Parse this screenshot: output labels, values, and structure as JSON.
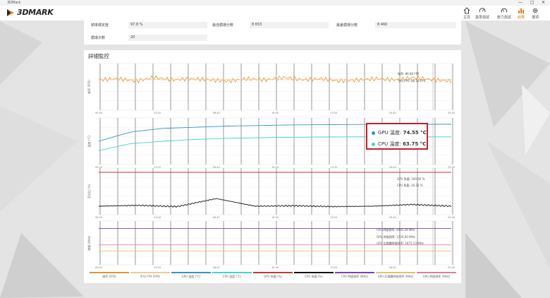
{
  "window": {
    "title": "3DMark",
    "controls": [
      "—",
      "□",
      "✕"
    ]
  },
  "app": {
    "logo_text": "3DMARK",
    "accent": "#d97a1c"
  },
  "nav": [
    {
      "label": "主頁",
      "icon": "home-icon"
    },
    {
      "label": "基準測試",
      "icon": "speedometer-icon"
    },
    {
      "label": "壓力測試",
      "icon": "gauge-icon"
    },
    {
      "label": "結果",
      "icon": "bar-chart-icon",
      "active": true
    },
    {
      "label": "選項",
      "icon": "gear-icon"
    }
  ],
  "summary": {
    "frame_stability_label": "幀率穩定度",
    "frame_stability_value": "97.8 %",
    "best_loop_label": "最佳循環分數",
    "best_loop_value": "8 653",
    "worst_loop_label": "最差循環分數",
    "worst_loop_value": "8 460",
    "loop_count_label": "循環次數",
    "loop_count_value": "20"
  },
  "detail": {
    "title": "詳細監控"
  },
  "chart_data": [
    {
      "type": "line",
      "ylabel": "幀率 (FPS)",
      "series": [
        {
          "name": "幀率",
          "color": "#e8922a",
          "values": [
            86,
            87,
            85,
            88,
            86,
            87,
            86,
            85,
            87,
            86,
            88,
            86,
            87,
            85,
            86,
            87,
            86,
            88,
            86,
            85
          ]
        },
        {
          "name": "平均 FPS",
          "color": "#f3c89a",
          "values": [
            86.16,
            86.16,
            86.16,
            86.16
          ]
        }
      ],
      "tooltip": [
        "幀率: 86.86 FPS",
        "平均 FPS: 86.16 FPS"
      ],
      "xticks": [
        "00:00",
        "03:20",
        "06:40",
        "10:00",
        "13:20",
        "16:40",
        "20:00"
      ]
    },
    {
      "type": "line",
      "ylabel": "溫度 (°C)",
      "series": [
        {
          "name": "GPU 溫度",
          "color": "#2f96c7",
          "values": [
            60,
            68,
            71,
            72,
            73,
            73.5,
            74,
            74.2,
            74.4,
            74.5,
            74.55,
            74.55
          ]
        },
        {
          "name": "CPU 溫度",
          "color": "#3fd6c5",
          "values": [
            52,
            58,
            60,
            61.5,
            62.5,
            63,
            63.4,
            63.6,
            63.75,
            63.75,
            63.75,
            63.75
          ]
        }
      ],
      "tooltip": [
        {
          "label": "GPU 溫度:",
          "value": "74.55 °C",
          "color": "#2f96c7"
        },
        {
          "label": "CPU 溫度:",
          "value": "63.75 °C",
          "color": "#3fd6c5"
        }
      ],
      "xticks": [
        "00:00",
        "03:20",
        "06:40",
        "10:00",
        "13:20",
        "16:40",
        "20:00"
      ]
    },
    {
      "type": "line",
      "ylabel": "百分比 (%)",
      "series": [
        {
          "name": "GPU 負載",
          "color": "#c0392b",
          "values": [
            100,
            100,
            100,
            100
          ]
        },
        {
          "name": "CPU 負載",
          "color": "#111111",
          "values": [
            20,
            22,
            19,
            38,
            20,
            21,
            19,
            20,
            24,
            20
          ]
        }
      ],
      "tooltip": [
        "GPU 負載: 100.00 %",
        "CPU 負載: 20.33 %"
      ],
      "xticks": [
        "00:00",
        "03:20",
        "06:40",
        "10:00",
        "13:20",
        "16:40",
        "20:00"
      ]
    },
    {
      "type": "line",
      "ylabel": "時脈 (MHz)",
      "series": [
        {
          "name": "CPU 時脈頻率",
          "color": "#7b3fbf",
          "values": [
            4995.29,
            4995.29
          ]
        },
        {
          "name": "GPU 時脈頻率",
          "color": "#e07aa4",
          "values": [
            2730,
            2730
          ]
        },
        {
          "name": "GPU 記憶體時脈頻率",
          "color": "#e5c06a",
          "values": [
            1875.13,
            1875.13
          ]
        }
      ],
      "tooltip": [
        "CPU 時脈頻率: 4995.29 MHz",
        "GPU 時脈頻率: 2730.00 MHz",
        "GPU 記憶體時脈頻率: 1875.13 MHz"
      ],
      "xticks": [
        "00:00",
        "03:20",
        "06:40",
        "10:00",
        "13:20",
        "16:40",
        "20:00"
      ]
    }
  ],
  "legend": [
    {
      "label": "幀率 (FPS)",
      "color": "#e8922a"
    },
    {
      "label": "平均 FPS (FPS)",
      "color": "#f3c89a"
    },
    {
      "label": "GPU 溫度 (°C)",
      "color": "#2f96c7"
    },
    {
      "label": "CPU 溫度 (°C)",
      "color": "#3fd6c5"
    },
    {
      "label": "GPU 負載 (%)",
      "color": "#c0392b"
    },
    {
      "label": "CPU 負載 (%)",
      "color": "#111111"
    },
    {
      "label": "CPU 時脈頻率 (MHz)",
      "color": "#7b3fbf"
    },
    {
      "label": "GPU 記憶體時脈頻率 (MHz)",
      "color": "#e5c06a"
    },
    {
      "label": "GPU 時脈頻率 (MHz)",
      "color": "#e07aa4"
    }
  ]
}
